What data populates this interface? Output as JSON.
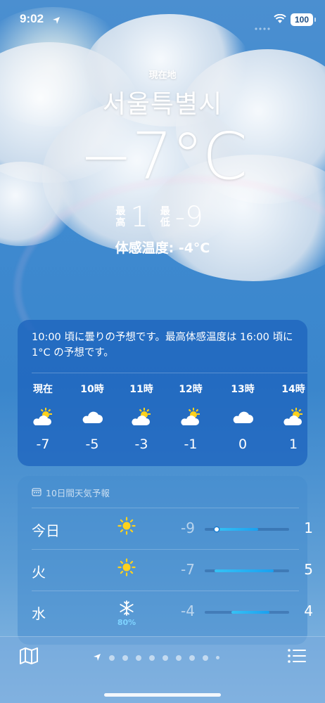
{
  "status_bar": {
    "time": "9:02",
    "battery": "100"
  },
  "location": {
    "label": "現在地",
    "city": "서울특별시"
  },
  "current": {
    "temp": "−7°C",
    "high_label_1": "最",
    "high_label_2": "高",
    "high": "1",
    "low_label_1": "最",
    "low_label_2": "低",
    "low": "-9",
    "feels_like": "体感温度: -4°C"
  },
  "hourly": {
    "summary": "10:00 頃に曇りの予想です。最高体感温度は 16:00 頃に 1°C の予想です。",
    "hours": [
      {
        "label": "現在",
        "icon": "partly-sunny-icon",
        "temp": "-7"
      },
      {
        "label": "10時",
        "icon": "cloud-icon",
        "temp": "-5"
      },
      {
        "label": "11時",
        "icon": "partly-sunny-icon",
        "temp": "-3"
      },
      {
        "label": "12時",
        "icon": "partly-sunny-icon",
        "temp": "-1"
      },
      {
        "label": "13時",
        "icon": "cloud-icon",
        "temp": "0"
      },
      {
        "label": "14時",
        "icon": "partly-sunny-icon",
        "temp": "1"
      }
    ]
  },
  "forecast": {
    "title": "10日間天気予報",
    "days": [
      {
        "day": "今日",
        "icon": "sun-icon",
        "precip": "",
        "low": "-9",
        "high": "1",
        "range": [
          0.14,
          0.63
        ],
        "current": 0.14
      },
      {
        "day": "火",
        "icon": "sun-icon",
        "precip": "",
        "low": "-7",
        "high": "5",
        "range": [
          0.12,
          0.82
        ],
        "current": null
      },
      {
        "day": "水",
        "icon": "snowflake-icon",
        "precip": "80%",
        "low": "-4",
        "high": "4",
        "range": [
          0.32,
          0.77
        ],
        "current": null
      }
    ]
  },
  "toolbar": {
    "page_count": 9,
    "active_page": 0
  },
  "colors": {
    "accent_bar": "#1aa0f0",
    "sun": "#ffd21c",
    "precip": "#7fd3ff"
  }
}
